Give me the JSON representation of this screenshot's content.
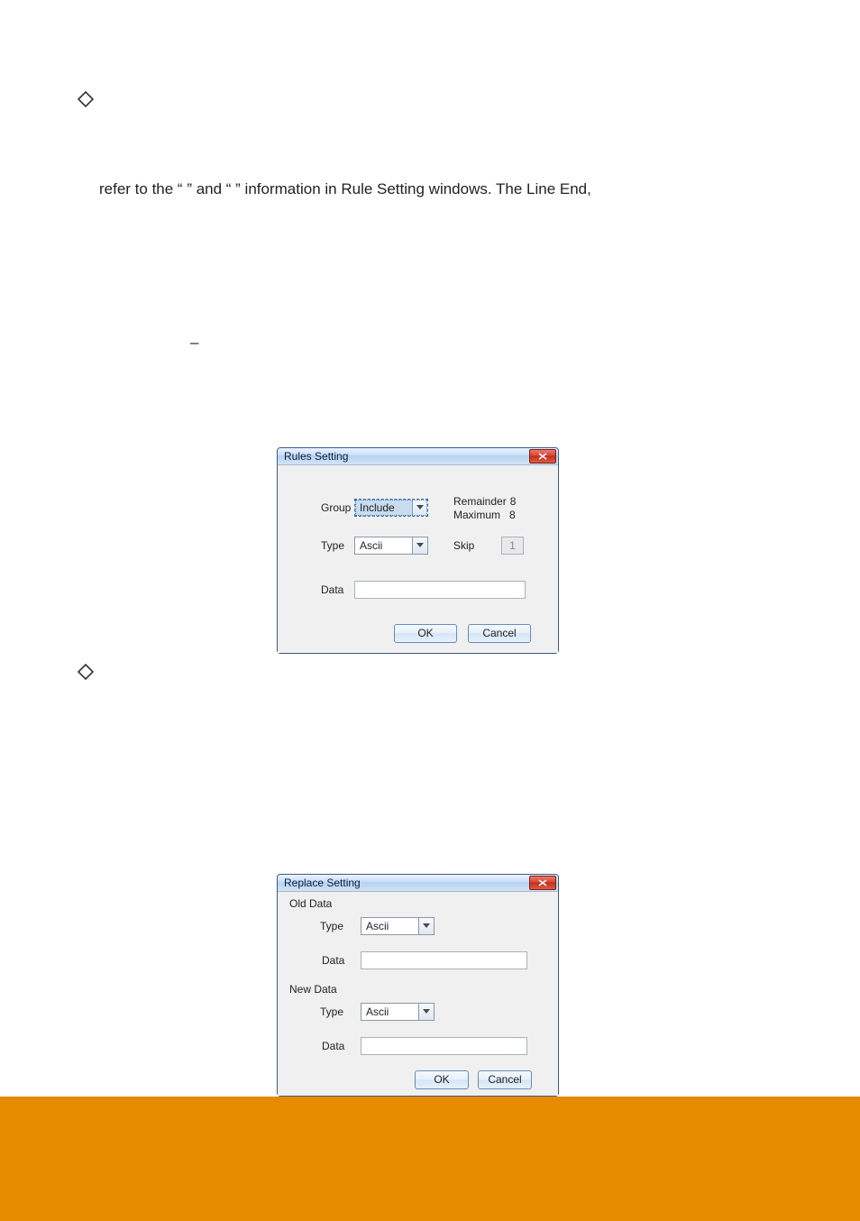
{
  "page_text": {
    "line1": "refer to the “                ” and “                  ” information in Rule Setting windows. The Line End,"
  },
  "dialogs": {
    "rules": {
      "title": "Rules Setting",
      "labels": {
        "group": "Group",
        "type": "Type",
        "data": "Data",
        "remainder": "Remainder",
        "maximum": "Maximum",
        "skip": "Skip"
      },
      "values": {
        "group_select": "Include",
        "type_select": "Ascii",
        "remainder_value": "8",
        "maximum_value": "8",
        "skip_value": "1",
        "data_value": ""
      },
      "buttons": {
        "ok": "OK",
        "cancel": "Cancel"
      }
    },
    "replace": {
      "title": "Replace Setting",
      "sections": {
        "old": "Old Data",
        "new": "New Data"
      },
      "labels": {
        "type": "Type",
        "data": "Data"
      },
      "values": {
        "old_type": "Ascii",
        "old_data": "",
        "new_type": "Ascii",
        "new_data": ""
      },
      "buttons": {
        "ok": "OK",
        "cancel": "Cancel"
      }
    }
  }
}
